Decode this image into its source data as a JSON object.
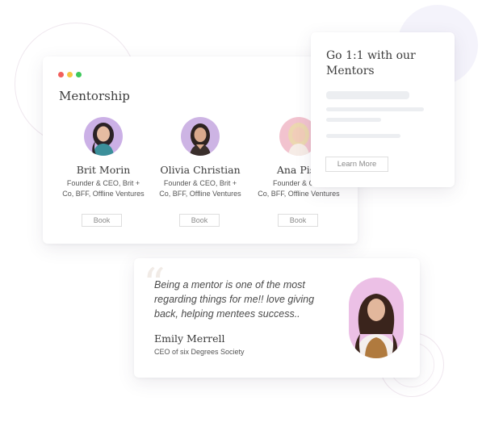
{
  "mentorship": {
    "window_dots": [
      "#f25f5c",
      "#f5c542",
      "#3cc85a"
    ],
    "title": "Mentorship",
    "mentors": [
      {
        "name": "Brit Morin",
        "role": "Founder & CEO, Brit +\nCo, BFF, Offline Ventures",
        "book_label": "Book",
        "avatar_bg": "#cbb0e6"
      },
      {
        "name": "Olivia Christian",
        "role": "Founder & CEO, Brit +\nCo, BFF, Offline Ventures",
        "book_label": "Book",
        "avatar_bg": "#cdb4e4"
      },
      {
        "name": "Ana Pisc",
        "role": "Founder & CEO\nCo, BFF, Offline Ventures",
        "book_label": "Book",
        "avatar_bg": "#f2c3cf"
      }
    ]
  },
  "go_card": {
    "title": "Go 1:1 with our Mentors",
    "learn_more_label": "Learn More"
  },
  "testimonial": {
    "quote_mark": "“",
    "quote": "Being a mentor is one of the most regarding things for me!! love giving back, helping mentees success..",
    "author": "Emily Merrell",
    "author_role": "CEO of six Degrees Society",
    "portrait_bg": "#ecc0e6"
  }
}
